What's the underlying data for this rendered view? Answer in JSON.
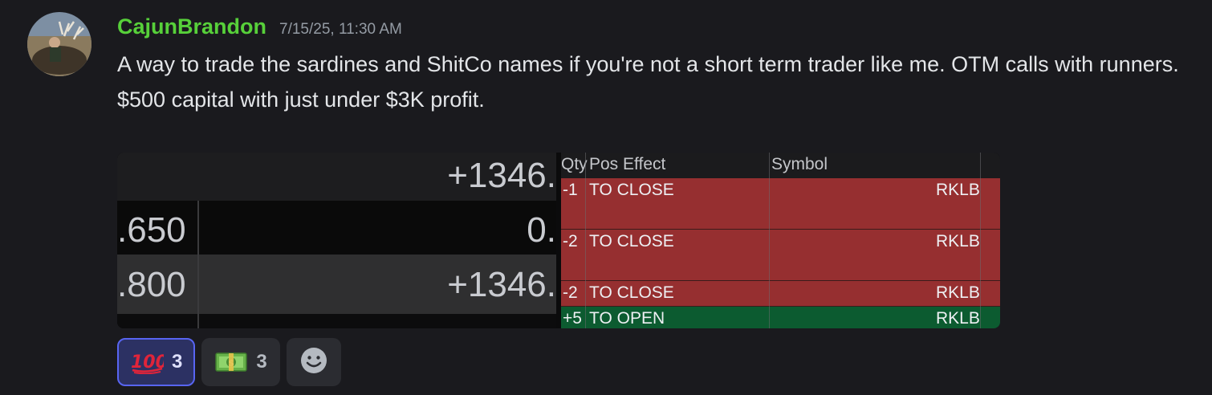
{
  "message": {
    "author": "CajunBrandon",
    "timestamp": "7/15/25, 11:30 AM",
    "username_color": "#57d03a",
    "lines": [
      "A way to trade the sardines and ShitCo names if you're not a short term trader like me.  OTM calls with runners.",
      "$500 capital with just under $3K profit."
    ]
  },
  "attachment": {
    "left_panel": {
      "total": "+1346.",
      "rows": [
        {
          "price": ".650",
          "value": "0."
        },
        {
          "price": ".800",
          "value": "+1346."
        }
      ]
    },
    "table": {
      "headers": {
        "qty": "Qty",
        "pos_effect": "Pos Effect",
        "symbol": "Symbol"
      },
      "rows": [
        {
          "qty": "-1",
          "pos_effect": "TO CLOSE",
          "symbol": "RKLB",
          "color": "#962f30"
        },
        {
          "qty": "-2",
          "pos_effect": "TO CLOSE",
          "symbol": "RKLB",
          "color": "#962f30"
        },
        {
          "qty": "-2",
          "pos_effect": "TO CLOSE",
          "symbol": "RKLB",
          "color": "#962f30"
        },
        {
          "qty": "+5",
          "pos_effect": "TO OPEN",
          "symbol": "RKLB",
          "color": "#0c5b30"
        }
      ]
    }
  },
  "reactions": [
    {
      "emoji": "hundred-points-icon",
      "count": "3",
      "active": true
    },
    {
      "emoji": "dollar-banknote-icon",
      "count": "3",
      "active": false
    }
  ],
  "add_reaction_icon": "smiley-icon",
  "colors": {
    "accent": "#5865f2",
    "background": "#1a1a1e"
  }
}
